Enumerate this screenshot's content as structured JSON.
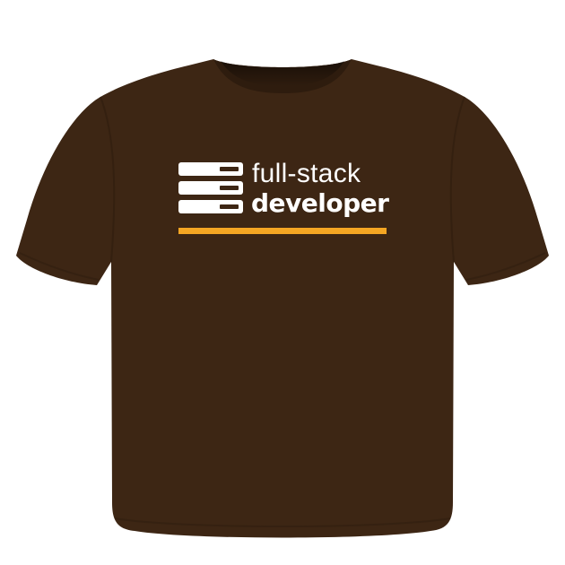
{
  "colors": {
    "shirt": "#3d2614",
    "shirt_shadow": "#2e1c0e",
    "background": "#ffffff",
    "ink": "#ffffff",
    "accent": "#f5a623"
  },
  "print": {
    "line1": "full-stack",
    "line2": "developer",
    "logo_icon": "server-stack-icon"
  }
}
